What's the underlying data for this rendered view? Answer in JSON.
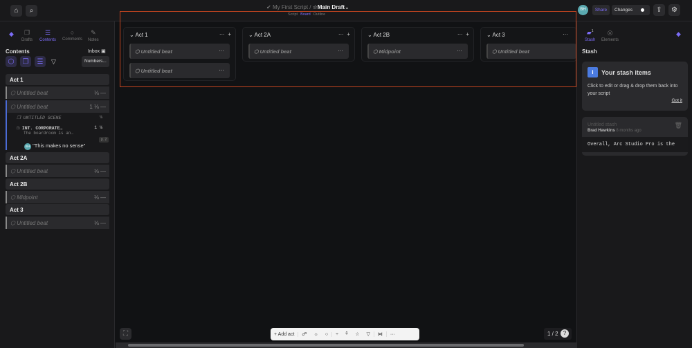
{
  "topbar": {
    "script_name": "My First Script",
    "separator": "/",
    "draft_name": "Main Draft",
    "views": [
      "Script",
      "Board",
      "Outline"
    ],
    "active_view": "Board",
    "avatar": "BH",
    "share": "Share",
    "changes": "Changes"
  },
  "left": {
    "tabs": [
      "Drafts",
      "Contents",
      "Comments",
      "Notes"
    ],
    "active_tab": "Contents",
    "title": "Contents",
    "inbox": "Inbox",
    "numbers": "Numbers...",
    "acts": [
      {
        "name": "Act 1",
        "items": [
          {
            "label": "Untitled beat",
            "meta": "⅛"
          },
          {
            "label": "Untitled beat",
            "meta": "1 ⅛"
          }
        ]
      },
      {
        "name": "Act 2A",
        "items": [
          {
            "label": "Untitled beat",
            "meta": "⅛"
          }
        ]
      },
      {
        "name": "Act 2B",
        "items": [
          {
            "label": "Midpoint",
            "meta": "⅛"
          }
        ]
      },
      {
        "name": "Act 3",
        "items": [
          {
            "label": "Untitled beat",
            "meta": "⅛"
          }
        ]
      }
    ],
    "scenes": [
      {
        "label": "UNTITLED SCENE",
        "meta": "⅛"
      },
      {
        "label": "INT. CORPORATE…",
        "sub": "The boardroom is an…",
        "meta": "1 ⅛"
      }
    ],
    "page_badge": "p. 2",
    "comment": "\"This makes no sense\""
  },
  "board": {
    "columns": [
      {
        "name": "Act 1",
        "beats": [
          "Untitled beat",
          "Untitled beat"
        ]
      },
      {
        "name": "Act 2A",
        "beats": [
          "Untitled beat"
        ]
      },
      {
        "name": "Act 2B",
        "beats": [
          "Midpoint"
        ]
      },
      {
        "name": "Act 3",
        "beats": [
          "Untitled beat"
        ]
      }
    ]
  },
  "right": {
    "tabs": [
      "Stash",
      "Elements"
    ],
    "active_tab": "Stash",
    "stash_badge": "1",
    "title": "Stash",
    "info_title": "Your stash items",
    "info_body": "Click to edit or drag & drop them back into your script",
    "got_it": "Got it",
    "stash_item": {
      "title": "Untitled stash",
      "author": "Brad Hawkins",
      "time": "8 months ago",
      "text": "Overall, Arc Studio Pro is the"
    }
  },
  "bottom": {
    "add_act": "+ Add act",
    "page": "1 / 2"
  },
  "colors": {
    "accent": "#7b6cf6",
    "highlight": "#c7451f"
  }
}
